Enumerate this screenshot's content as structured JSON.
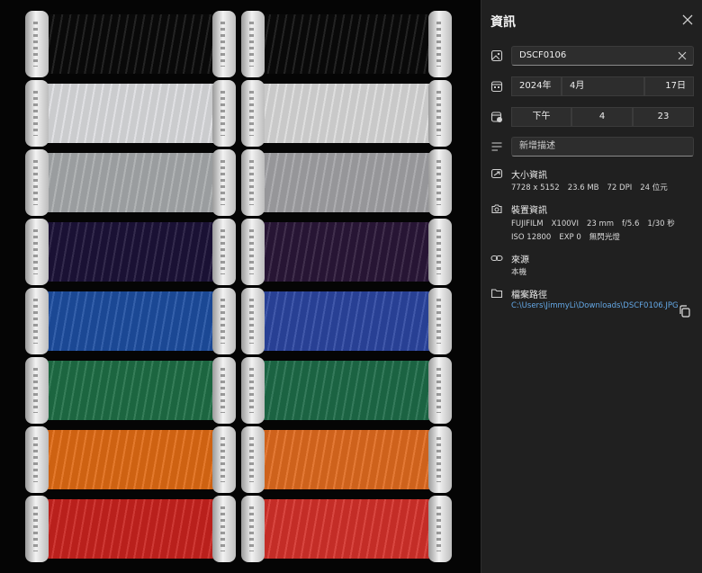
{
  "panel": {
    "title": "資訊",
    "filename": "DSCF0106",
    "date": {
      "year": "2024年",
      "month": "4月",
      "day": "17日"
    },
    "time": {
      "period": "下午",
      "hour": "4",
      "minute": "23"
    },
    "description_placeholder": "新增描述",
    "size": {
      "label": "大小資訊",
      "dimensions": "7728 x 5152",
      "filesize": "23.6 MB",
      "dpi": "72 DPI",
      "bits": "24 位元"
    },
    "device": {
      "label": "裝置資訊",
      "make": "FUJIFILM",
      "model": "X100VI",
      "focal": "23 mm",
      "aperture": "f/5.6",
      "shutter": "1/30 秒",
      "iso": "ISO 12800",
      "exposure": "EXP 0",
      "flash": "無閃光燈"
    },
    "source": {
      "label": "來源",
      "value": "本機"
    },
    "path": {
      "label": "檔案路徑",
      "value": "C:\\Users\\JimmyLi\\Downloads\\DSCF0106.JPG"
    }
  },
  "icons": {
    "close": "close-icon",
    "image": "image-icon",
    "calendar": "calendar-icon",
    "clock": "calendar-clock-icon",
    "description": "text-lines-icon",
    "size": "image-size-icon",
    "camera": "camera-icon",
    "link": "link-icon",
    "folder": "folder-icon",
    "copy": "copy-icon"
  },
  "photo": {
    "left_column": [
      "#0a0a0a",
      "#dcdde0",
      "#a7aaac",
      "#1c1238",
      "#1d4ea1",
      "#1e6e45",
      "#e06a14",
      "#c9231e"
    ],
    "right_column": [
      "#0a0a0a",
      "#dadada",
      "#a3a3a6",
      "#2a1738",
      "#2b45a0",
      "#1d6b48",
      "#e06a1e",
      "#d4312a"
    ],
    "colors": {
      "panel_bg": "#202020",
      "field_bg": "#2d2d2d",
      "link": "#64a8e6"
    }
  }
}
